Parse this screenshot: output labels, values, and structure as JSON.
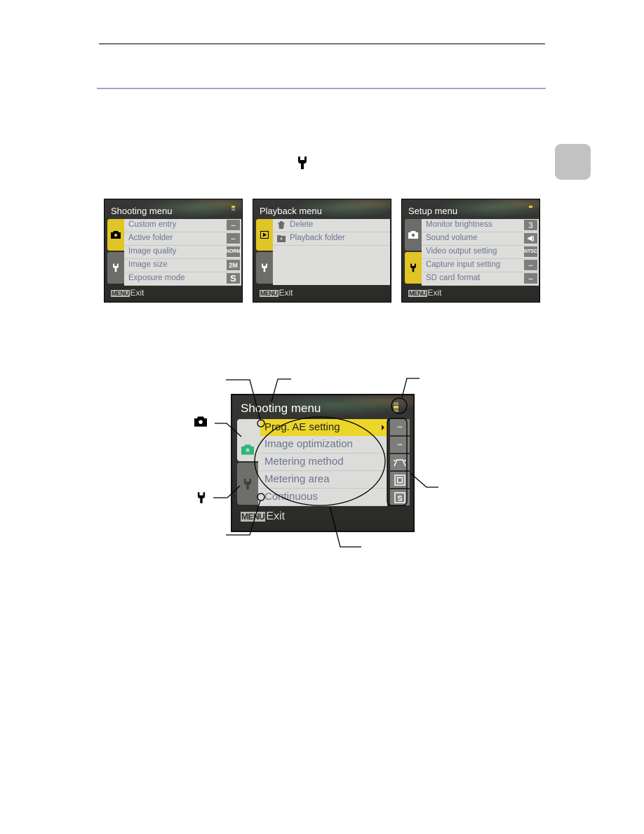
{
  "page": {
    "side_tab_color": "#c2c2c2",
    "rule_color": "#a7a5be"
  },
  "icons": {
    "inline": "wrench-icon",
    "camera": "camera-icon",
    "wrench": "wrench-icon"
  },
  "screens": [
    {
      "title": "Shooting menu",
      "tabs": [
        {
          "icon": "camera",
          "selected": true
        },
        {
          "icon": "wrench",
          "selected": false
        }
      ],
      "items": [
        {
          "label": "Custom entry",
          "value": "--"
        },
        {
          "label": "Active folder",
          "value": "--"
        },
        {
          "label": "Image quality",
          "value": "NORM"
        },
        {
          "label": "Image size",
          "value": "2M"
        },
        {
          "label": "Exposure mode",
          "value": "S"
        }
      ],
      "footer_key": "MENU",
      "footer_label": "Exit"
    },
    {
      "title": "Playback menu",
      "tabs": [
        {
          "icon": "play",
          "selected": true
        },
        {
          "icon": "wrench",
          "selected": false
        }
      ],
      "items": [
        {
          "label": "Delete",
          "icon": "trash"
        },
        {
          "label": "Playback folder",
          "icon": "folder-play"
        }
      ],
      "footer_key": "MENU",
      "footer_label": "Exit"
    },
    {
      "title": "Setup menu",
      "tabs": [
        {
          "icon": "camera",
          "selected": false
        },
        {
          "icon": "wrench",
          "selected": true
        }
      ],
      "items": [
        {
          "label": "Monitor brightness",
          "value": "3"
        },
        {
          "label": "Sound volume",
          "value": "speaker"
        },
        {
          "label": "Video output setting",
          "value": "NTSC"
        },
        {
          "label": "Capture input setting",
          "value": "--"
        },
        {
          "label": "SD card format",
          "value": "--"
        }
      ],
      "footer_key": "MENU",
      "footer_label": "Exit"
    }
  ],
  "large_screen": {
    "title": "Shooting menu",
    "items": [
      {
        "label": "Prog. AE setting",
        "value": "--",
        "highlighted": true
      },
      {
        "label": "Image optimization",
        "value": "--"
      },
      {
        "label": "Metering method",
        "value": "center-weighted"
      },
      {
        "label": "Metering area",
        "value": "area"
      },
      {
        "label": "Continuous",
        "value": "S"
      }
    ],
    "footer_key": "MENU",
    "footer_label": "Exit"
  }
}
